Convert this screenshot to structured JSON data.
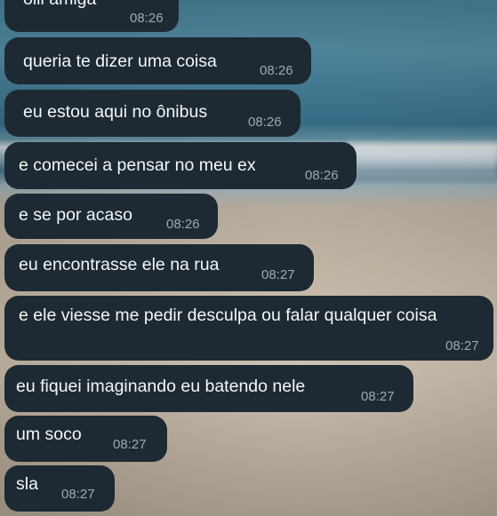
{
  "chat": {
    "messages": [
      {
        "text": "oiii amiga",
        "time": "08:26"
      },
      {
        "text": "queria te dizer uma coisa",
        "time": "08:26"
      },
      {
        "text": "eu estou aqui no ônibus",
        "time": "08:26"
      },
      {
        "text": "e comecei a pensar no meu ex",
        "time": "08:26"
      },
      {
        "text": "e se por acaso",
        "time": "08:26"
      },
      {
        "text": "eu encontrasse ele na rua",
        "time": "08:27"
      },
      {
        "text": "e ele viesse me pedir desculpa ou falar qualquer coisa",
        "time": "08:27"
      },
      {
        "text": "eu fiquei imaginando eu batendo nele",
        "time": "08:27"
      },
      {
        "text": "um soco",
        "time": "08:27"
      },
      {
        "text": "sla",
        "time": "08:27"
      }
    ]
  },
  "colors": {
    "bubble_background": "#1e2a33",
    "message_text": "#f4f6f7",
    "timestamp_text": "#9ea8ae"
  }
}
